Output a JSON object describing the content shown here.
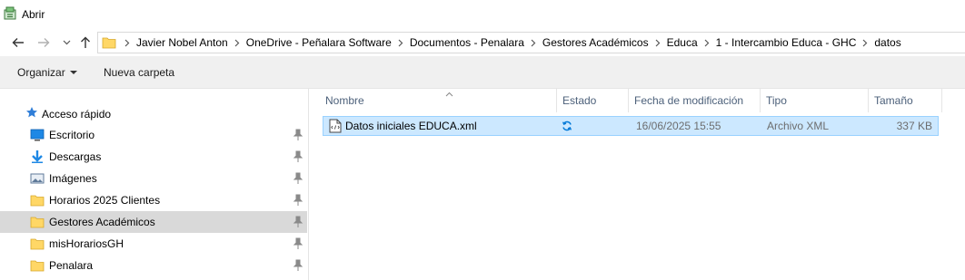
{
  "window": {
    "title": "Abrir",
    "icon": "open-dialog-icon"
  },
  "nav": {
    "back_icon": "arrow-left-icon",
    "forward_icon": "arrow-right-icon",
    "recent_icon": "chevron-down-icon",
    "up_icon": "arrow-up-icon"
  },
  "address": {
    "crumbs": [
      "Javier Nobel Anton",
      "OneDrive - Peñalara Software",
      "Documentos - Penalara",
      "Gestores Académicos",
      "Educa",
      "1 - Intercambio Educa - GHC",
      "datos"
    ]
  },
  "toolbar": {
    "organize_label": "Organizar",
    "new_folder_label": "Nueva carpeta"
  },
  "sidebar": {
    "quick_access_label": "Acceso rápido",
    "items": [
      {
        "label": "Escritorio",
        "icon": "desktop-icon",
        "pinned": true
      },
      {
        "label": "Descargas",
        "icon": "download-icon",
        "pinned": true
      },
      {
        "label": "Imágenes",
        "icon": "pictures-icon",
        "pinned": true
      },
      {
        "label": "Horarios 2025 Clientes",
        "icon": "folder-icon",
        "pinned": true
      },
      {
        "label": "Gestores Académicos",
        "icon": "folder-icon",
        "pinned": true,
        "selected": true
      },
      {
        "label": "misHorariosGH",
        "icon": "folder-icon",
        "pinned": true
      },
      {
        "label": "Penalara",
        "icon": "folder-icon",
        "pinned": true
      }
    ]
  },
  "columns": {
    "name": "Nombre",
    "status": "Estado",
    "modified": "Fecha de modificación",
    "type": "Tipo",
    "size": "Tamaño"
  },
  "files": [
    {
      "name": "Datos iniciales EDUCA.xml",
      "status_icon": "sync-icon",
      "modified": "16/06/2025 15:55",
      "type": "Archivo XML",
      "size": "337 KB"
    }
  ],
  "colors": {
    "selection_bg": "#cce8ff",
    "selection_border": "#99d1ff",
    "sidebar_selected": "#d9d9d9",
    "toolbar_bg": "#f0f0f0",
    "header_text": "#4c607a",
    "folder_yellow": "#ffd766",
    "accent_blue": "#0078d7"
  }
}
